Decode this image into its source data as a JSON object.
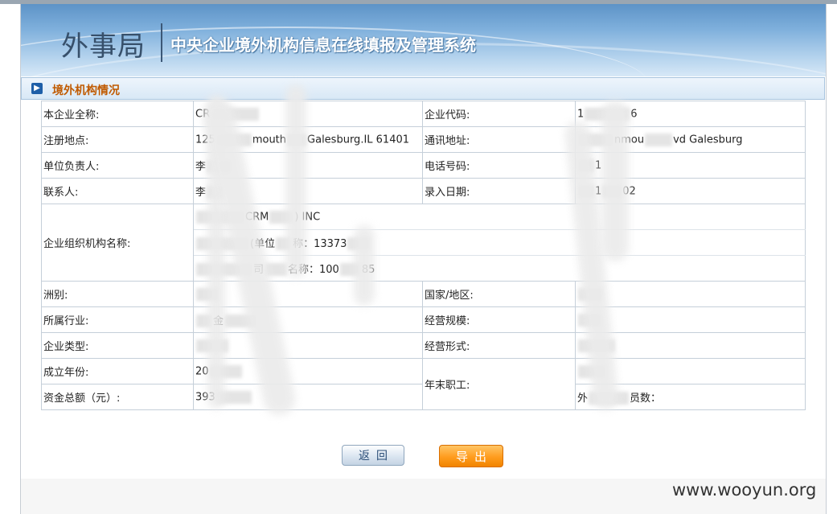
{
  "header": {
    "logo_text": "外事局",
    "system_title": "中央企业境外机构信息在线填报及管理系统"
  },
  "section": {
    "title": "境外机构情况",
    "icon": "arrow-right-icon"
  },
  "form": {
    "company_full_name_label": "本企业全称:",
    "company_full_name_value": "CR",
    "company_code_label": "企业代码:",
    "company_code_value_a": "1",
    "company_code_value_b": "6",
    "reg_address_label": "注册地点:",
    "reg_address_a": "125",
    "reg_address_b": "mouth",
    "reg_address_c": "Galesburg.IL 61401",
    "mail_address_label": "通讯地址:",
    "mail_address_a": "nmou",
    "mail_address_b": "vd Galesburg",
    "unit_head_label": "单位负责人:",
    "unit_head_value": "李",
    "phone_label": "电话号码:",
    "phone_value": "1",
    "contact_label": "联系人:",
    "contact_value": "李",
    "entry_date_label": "录入日期:",
    "entry_date_a": "1",
    "entry_date_b": "02",
    "org_name_label": "企业组织机构名称:",
    "org_line1_a": "CRM",
    "org_line1_b": ") INC",
    "org_line2_a": "(单位",
    "org_line2_b": "称：13373",
    "org_line3_a": "司",
    "org_line3_b": "名称：100",
    "org_line3_c": "85",
    "continent_label": "洲别:",
    "continent_value": "",
    "country_label": "国家/地区:",
    "country_value": "",
    "industry_label": "所属行业:",
    "industry_value": "金",
    "scale_label": "经营规模:",
    "scale_value": "",
    "ent_type_label": "企业类型:",
    "ent_type_value": "",
    "biz_form_label": "经营形式:",
    "biz_form_value": "",
    "founded_label": "成立年份:",
    "founded_value": "20",
    "year_end_staff_label": "年末职工:",
    "year_end_staff_value": "",
    "total_capital_label": "资金总额（元）:",
    "total_capital_value": "393",
    "foreign_staff_label": "外",
    "foreign_staff_label_b": "员数："
  },
  "buttons": {
    "back": "返回",
    "export": "导出"
  },
  "watermark": "www.wooyun.org",
  "colors": {
    "section_title": "#c05a00",
    "export_button": "#ff9c1e",
    "banner": "#7fb0dc"
  }
}
